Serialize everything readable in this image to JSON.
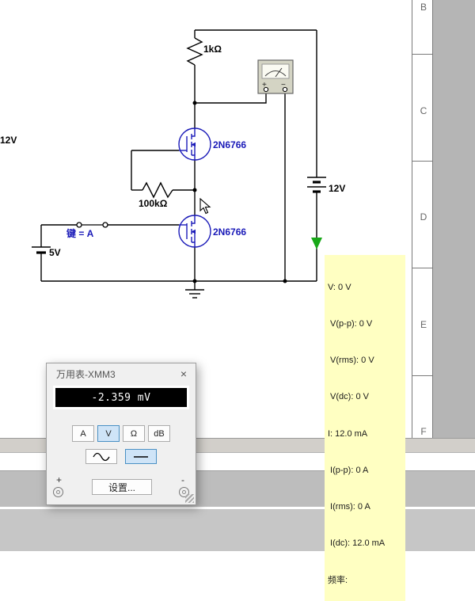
{
  "schematic": {
    "r1_value": "1kΩ",
    "r2_value": "100kΩ",
    "q1_label": "2N6766",
    "q2_label": "2N6766",
    "v_right_label": "12V",
    "v_left_edge_label": "12V",
    "v2_label": "5V",
    "switch_label": "键 = A",
    "xmm_plus": "+",
    "xmm_minus": "−"
  },
  "probe_readout": {
    "lines": [
      "V: 0 V",
      " V(p-p): 0 V",
      " V(rms): 0 V",
      " V(dc): 0 V",
      "I: 12.0 mA",
      " I(p-p): 0 A",
      " I(rms): 0 A",
      " I(dc): 12.0 mA",
      "频率:"
    ]
  },
  "sheet_border": {
    "letters": [
      "B",
      "C",
      "D",
      "E",
      "F"
    ]
  },
  "multimeter": {
    "title": "万用表-XMM3",
    "close_glyph": "×",
    "reading": "-2.359 mV",
    "modes": [
      "A",
      "V",
      "Ω",
      "dB"
    ],
    "selected_mode": "V",
    "settings_label": "设置...",
    "plus_label": "+",
    "minus_label": "-"
  },
  "colors": {
    "component_blue": "#1a1ab8",
    "probe_green": "#18a818",
    "readout_bg": "#ffffc2",
    "selected_button_bg": "#cfe4f7"
  }
}
